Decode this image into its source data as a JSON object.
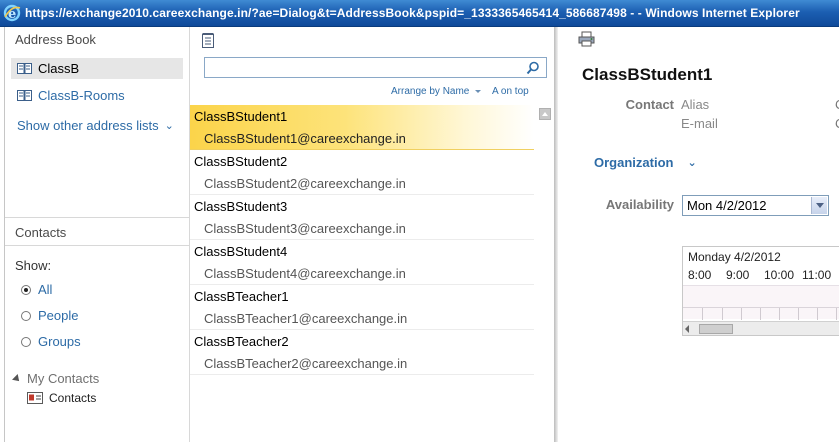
{
  "window": {
    "title": "https://exchange2010.careexchange.in/?ae=Dialog&t=AddressBook&pspid=_1333365465414_586687498 - - Windows Internet Explorer"
  },
  "left_pane": {
    "header": "Address Book",
    "books": [
      {
        "label": "ClassB",
        "selected": true
      },
      {
        "label": "ClassB-Rooms",
        "selected": false
      }
    ],
    "show_other": "Show other address lists",
    "contacts_header": "Contacts",
    "show_label": "Show:",
    "filters": [
      {
        "label": "All",
        "checked": true
      },
      {
        "label": "People",
        "checked": false
      },
      {
        "label": "Groups",
        "checked": false
      }
    ],
    "my_contacts": "My Contacts",
    "contacts_folder": "Contacts"
  },
  "middle_pane": {
    "search_placeholder": "",
    "arrange_by": "Arrange by Name",
    "sort_order": "A on top",
    "entries": [
      {
        "name": "ClassBStudent1",
        "email": "ClassBStudent1@careexchange.in",
        "selected": true
      },
      {
        "name": "ClassBStudent2",
        "email": "ClassBStudent2@careexchange.in",
        "selected": false
      },
      {
        "name": "ClassBStudent3",
        "email": "ClassBStudent3@careexchange.in",
        "selected": false
      },
      {
        "name": "ClassBStudent4",
        "email": "ClassBStudent4@careexchange.in",
        "selected": false
      },
      {
        "name": "ClassBTeacher1",
        "email": "ClassBTeacher1@careexchange.in",
        "selected": false
      },
      {
        "name": "ClassBTeacher2",
        "email": "ClassBTeacher2@careexchange.in",
        "selected": false
      }
    ]
  },
  "detail": {
    "name": "ClassBStudent1",
    "contact_label": "Contact",
    "alias_label": "Alias",
    "email_label": "E-mail",
    "clipped_value": "C",
    "organization": "Organization",
    "availability_label": "Availability",
    "date_value": "Mon 4/2/2012",
    "schedule_date": "Monday 4/2/2012",
    "hours": [
      "8:00",
      "9:00",
      "10:00",
      "11:00"
    ]
  },
  "colors": {
    "link": "#2d6ba6",
    "selection": "#fbd44a",
    "titlebar": "#1c5fb2"
  }
}
